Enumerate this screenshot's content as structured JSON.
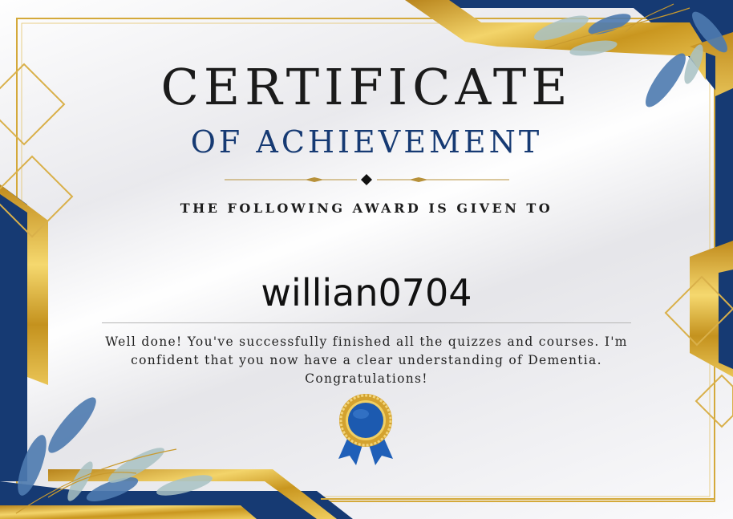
{
  "certificate": {
    "title": "CERTIFICATE",
    "subtitle": "OF ACHIEVEMENT",
    "given_to_label": "THE FOLLOWING AWARD IS GIVEN TO",
    "recipient_name": "willian0704",
    "message": "Well done! You've successfully finished all the quizzes and courses. I'm confident that you now have a clear understanding of Dementia. Congratulations!"
  },
  "colors": {
    "navy": "#163a73",
    "gold": "#d8aa2e",
    "text": "#1b1b1b"
  },
  "icons": [
    "award-ribbon-icon",
    "diamond-divider-icon",
    "leaf-decoration-icon"
  ]
}
